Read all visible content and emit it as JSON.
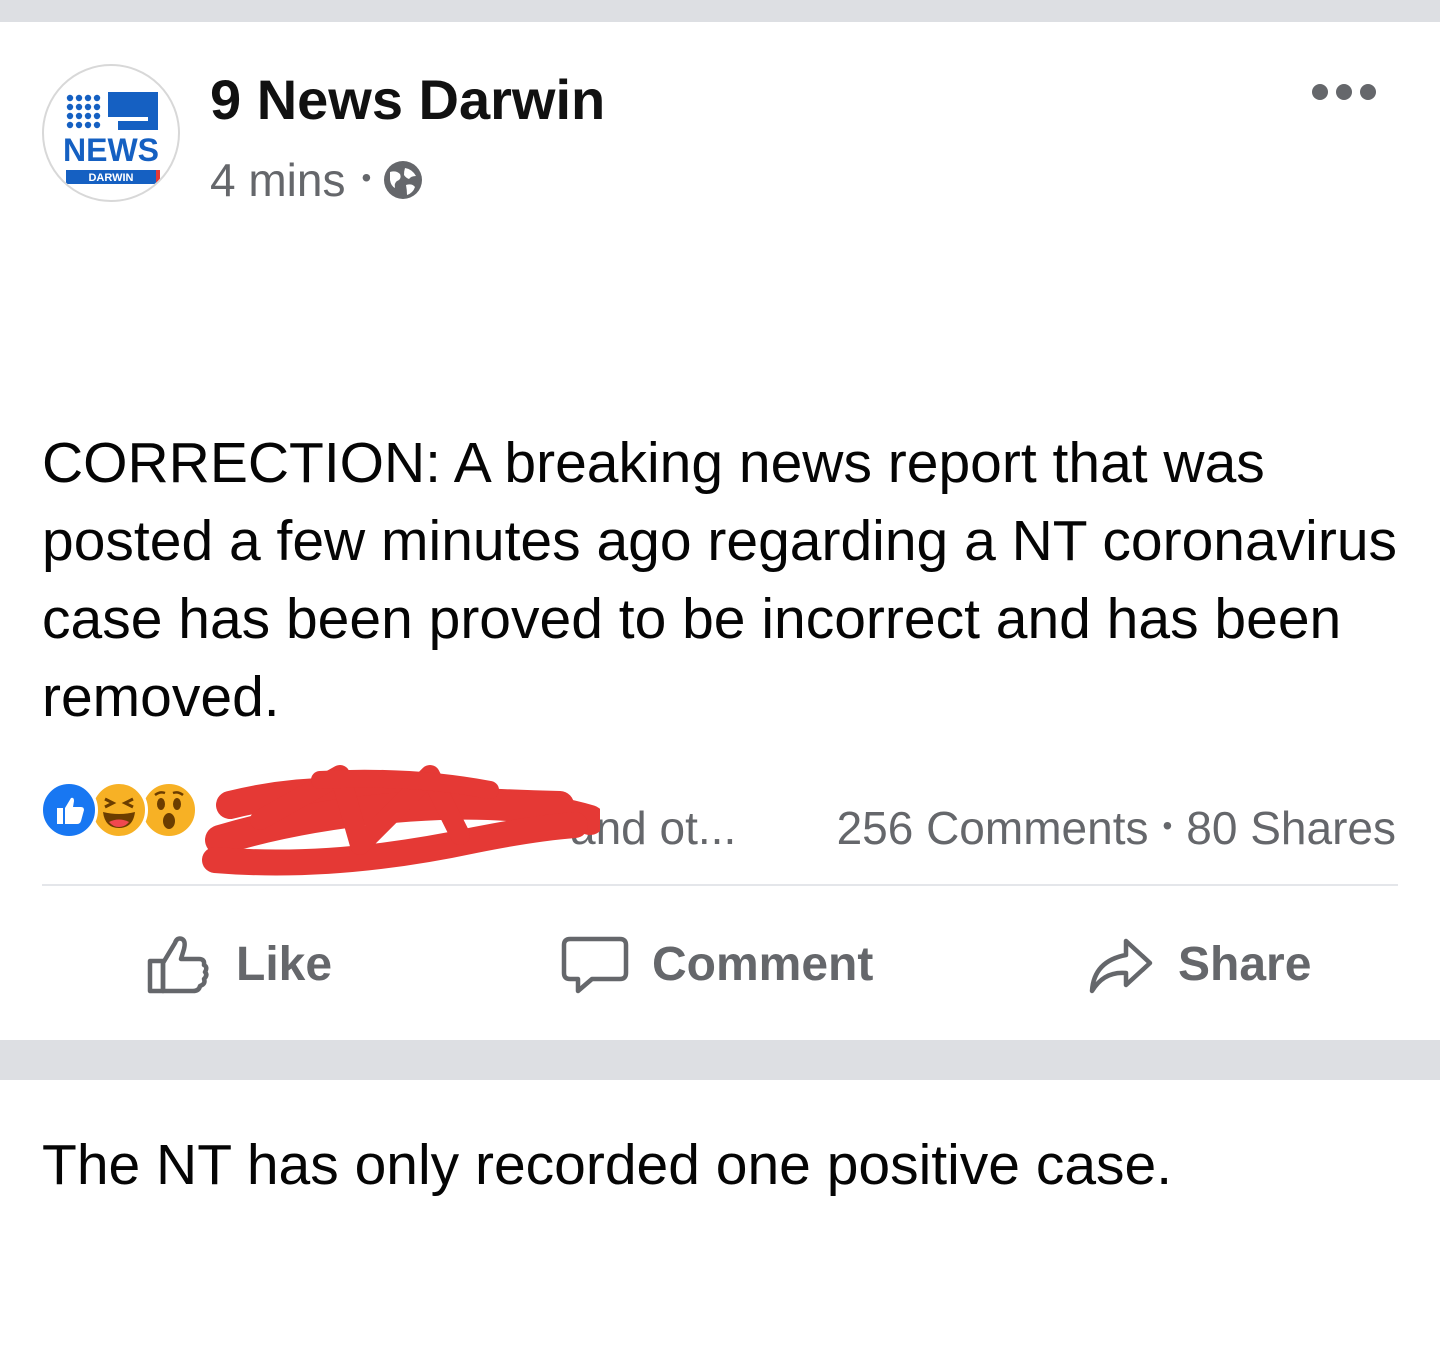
{
  "post": {
    "page_name": "9 News Darwin",
    "time": "4 mins",
    "separator": "•",
    "avatar": {
      "logo_text": "NEWS",
      "logo_subtext": "DARWIN"
    },
    "text_paragraphs": [
      "CORRECTION: A breaking news report that was posted a few minutes ago regarding a NT coronavirus case has been proved to be incorrect and has been removed.",
      "The NT has only recorded one positive case."
    ],
    "reactions": {
      "types": [
        "like",
        "haha",
        "wow"
      ],
      "reactor_summary_visible": "and ot..."
    },
    "counts": {
      "comments": "256 Comments",
      "shares": "80 Shares",
      "separator": "•"
    },
    "actions": {
      "like_label": "Like",
      "comment_label": "Comment",
      "share_label": "Share"
    }
  },
  "colors": {
    "background": "#ffffff",
    "strip": "#dddfe3",
    "secondary_text": "#65676b",
    "primary_text": "#050505",
    "like_blue": "#1877f2",
    "reaction_yellow": "#f7b125",
    "logo_blue": "#1560c2",
    "redaction_red": "#e53935"
  }
}
